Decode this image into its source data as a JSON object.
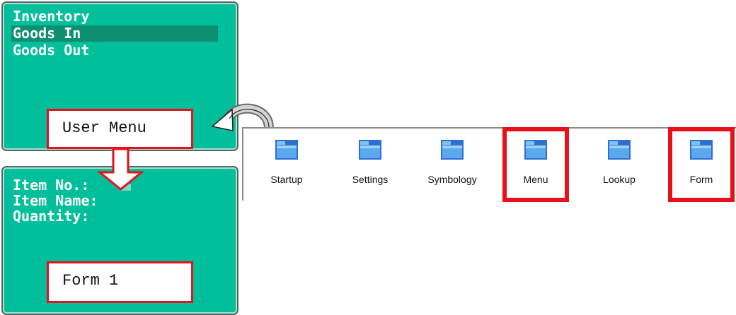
{
  "menu_screen": {
    "lines": [
      "Inventory",
      "Goods In",
      "Goods Out"
    ],
    "selected_index": 1
  },
  "form_screen": {
    "lines": [
      "Item No.:",
      "Item Name:",
      "Quantity:"
    ]
  },
  "callouts": {
    "user_menu": "User Menu",
    "form_1": "Form 1"
  },
  "explorer": {
    "folders": [
      {
        "label": "Startup",
        "icon": "folder-icon",
        "highlighted": false
      },
      {
        "label": "Settings",
        "icon": "folder-icon",
        "highlighted": false
      },
      {
        "label": "Symbology",
        "icon": "folder-icon",
        "highlighted": false
      },
      {
        "label": "Menu",
        "icon": "folder-icon",
        "highlighted": true
      },
      {
        "label": "Lookup",
        "icon": "folder-icon",
        "highlighted": false
      },
      {
        "label": "Form",
        "icon": "folder-icon",
        "highlighted": true
      }
    ]
  },
  "colors": {
    "terminal_bg": "#00bf9a",
    "terminal_highlight": "#0f8f72",
    "terminal_text": "#ffffff",
    "highlight_red": "#e8101b",
    "folder_blue": "#3d8ee6"
  }
}
